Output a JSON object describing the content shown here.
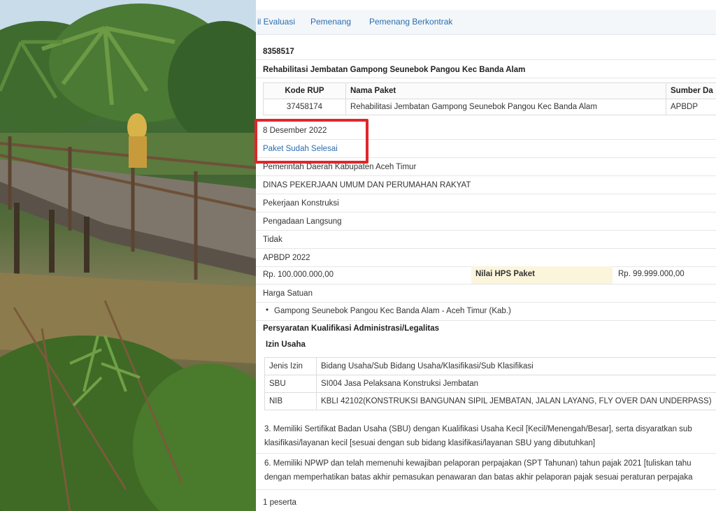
{
  "tabs": [
    "il Evaluasi",
    "Pemenang",
    "Pemenang Berkontrak"
  ],
  "package": {
    "code": "8358517",
    "name": "Rehabilitasi Jembatan Gampong Seunebok Pangou Kec Banda Alam",
    "rup_headers": [
      "Kode RUP",
      "Nama Paket",
      "Sumber Da"
    ],
    "rup_row": [
      "37458174",
      "Rehabilitasi Jembatan Gampong Seunebok Pangou Kec Banda Alam",
      "APBDP"
    ],
    "date": "8 Desember 2022",
    "status": "Paket Sudah Selesai",
    "instansi": "Pemerintah Daerah Kabupaten Aceh Timur",
    "satker": "DINAS PEKERJAAN UMUM DAN PERUMAHAN RAKYAT",
    "kategori": "Pekerjaan Konstruksi",
    "metode": "Pengadaan Langsung",
    "flag": "Tidak",
    "tahun_anggaran": "APBDP 2022",
    "pagu": "Rp. 100.000.000,00",
    "hps_label": "Nilai HPS Paket",
    "hps_value": "Rp. 99.999.000,00",
    "jenis_kontrak": "Harga Satuan",
    "lokasi": "Gampong Seunebok Pangou Kec Banda Alam - Aceh Timur (Kab.)"
  },
  "kualifikasi": {
    "title": "Persyaratan Kualifikasi Administrasi/Legalitas",
    "subtitle": "Izin Usaha",
    "headers": [
      "Jenis Izin",
      "Bidang Usaha/Sub Bidang Usaha/Klasifikasi/Sub Klasifikasi"
    ],
    "rows": [
      [
        "SBU",
        "SI004 Jasa Pelaksana Konstruksi Jembatan"
      ],
      [
        "NIB",
        "KBLI 42102(KONSTRUKSI BANGUNAN SIPIL JEMBATAN, JALAN LAYANG, FLY OVER DAN UNDERPASS)"
      ]
    ],
    "req3_line1": "3. Memiliki Sertifikat Badan Usaha (SBU) dengan Kualifikasi Usaha Kecil [Kecil/Menengah/Besar], serta disyaratkan sub",
    "req3_line2": "klasifikasi/layanan kecil [sesuai dengan sub bidang klasifikasi/layanan SBU yang dibutuhkan]",
    "req6_line1": "6. Memiliki NPWP dan telah memenuhi kewajiban pelaporan perpajakan (SPT Tahunan) tahun pajak 2021 [tuliskan tahu",
    "req6_line2": "dengan memperhatikan batas akhir pemasukan penawaran dan batas akhir pelaporan pajak sesuai peraturan perpajaka"
  },
  "peserta": "1 peserta",
  "colors": {
    "highlight": "#e0262a",
    "link": "#2a6db0",
    "hps_bg": "#fbf5dc"
  }
}
